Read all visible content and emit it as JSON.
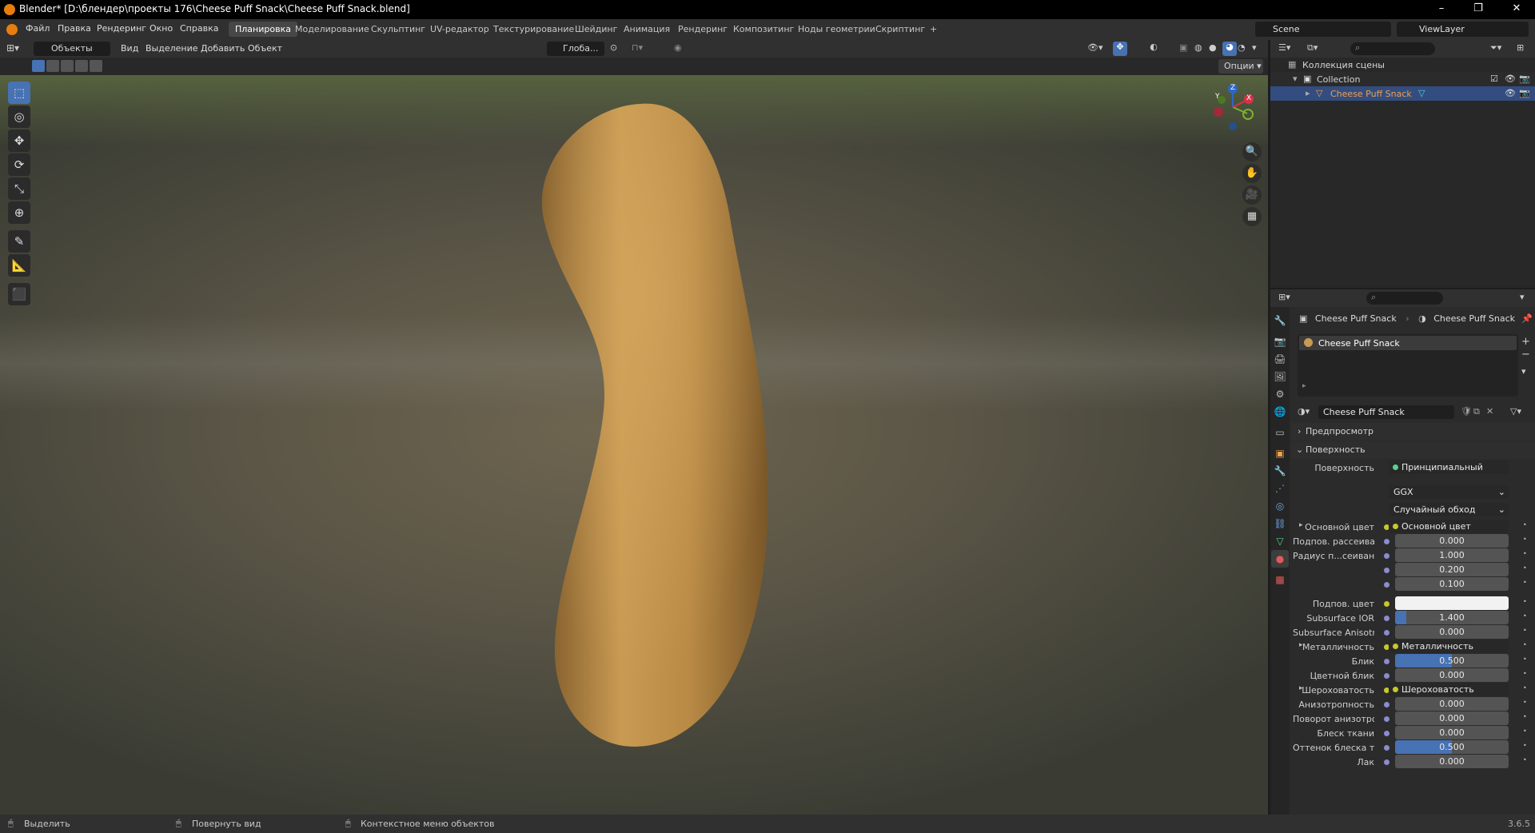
{
  "window": {
    "title": "Blender* [D:\\блендер\\проекты 176\\Cheese Puff Snack\\Cheese Puff Snack.blend]",
    "minimize": "–",
    "maximize": "❐",
    "close": "✕"
  },
  "menu": {
    "items": [
      "Файл",
      "Правка",
      "Рендеринг",
      "Окно",
      "Справка"
    ],
    "workspaces": [
      "Планировка",
      "Моделирование",
      "Скульптинг",
      "UV-редактор",
      "Текстурирование",
      "Шейдинг",
      "Анимация",
      "Рендеринг",
      "Композитинг",
      "Ноды геометрии",
      "Скриптинг"
    ],
    "active_workspace": "Планировка",
    "add_workspace": "+",
    "scene": "Scene",
    "view_layer": "ViewLayer"
  },
  "viewport_header": {
    "mode": "Объекты",
    "menus": [
      "Вид",
      "Выделение",
      "Добавить",
      "Объект"
    ],
    "orientation": "Глоба...",
    "options": "Опции"
  },
  "gizmo": {
    "z": "Z",
    "y": "Y",
    "x": "X"
  },
  "outliner": {
    "scene_collection": "Коллекция сцены",
    "collection": "Collection",
    "object": "Cheese Puff Snack"
  },
  "properties": {
    "breadcrumb_object": "Cheese Puff Snack",
    "breadcrumb_material": "Cheese Puff Snack",
    "slot_name": "Cheese Puff Snack",
    "material_name": "Cheese Puff Snack",
    "panel_preview": "Предпросмотр",
    "panel_surface": "Поверхность",
    "surface_label": "Поверхность",
    "surface_value": "Принципиальный BSDF",
    "distribution": "GGX",
    "subsurface_method": "Случайный обход",
    "fields": [
      {
        "label": "Основной цвет",
        "value": "Основной цвет",
        "type": "link",
        "expand": "▸"
      },
      {
        "label": "Подпов. рассеива...",
        "value": "0.000",
        "type": "num"
      },
      {
        "label": "Радиус п...сеивания",
        "value": "1.000",
        "type": "num"
      },
      {
        "label": "",
        "value": "0.200",
        "type": "num"
      },
      {
        "label": "",
        "value": "0.100",
        "type": "num"
      },
      {
        "label": "Подпов. цвет",
        "value": "",
        "type": "color"
      },
      {
        "label": "Subsurface IOR",
        "value": "1.400",
        "type": "num",
        "fill": 0.1
      },
      {
        "label": "Subsurface Anisotr...",
        "value": "0.000",
        "type": "num"
      },
      {
        "label": "Металличность",
        "value": "Металличность",
        "type": "link",
        "expand": "▸"
      },
      {
        "label": "Блик",
        "value": "0.500",
        "type": "num",
        "fill": 0.5
      },
      {
        "label": "Цветной блик",
        "value": "0.000",
        "type": "num"
      },
      {
        "label": "Шероховатость",
        "value": "Шероховатость",
        "type": "link",
        "expand": "▸"
      },
      {
        "label": "Анизотропность",
        "value": "0.000",
        "type": "num"
      },
      {
        "label": "Поворот анизотро...",
        "value": "0.000",
        "type": "num"
      },
      {
        "label": "Блеск ткани",
        "value": "0.000",
        "type": "num"
      },
      {
        "label": "Оттенок блеска тк...",
        "value": "0.500",
        "type": "num",
        "fill": 0.5
      },
      {
        "label": "Лак",
        "value": "0.000",
        "type": "num"
      }
    ]
  },
  "status": {
    "select": "Выделить",
    "rotate": "Повернуть вид",
    "context": "Контекстное меню объектов",
    "version": "3.6.5"
  },
  "colors": {
    "accent": "#4772b3",
    "puff": "#b88a45",
    "selected_object": "#f0a04a"
  }
}
